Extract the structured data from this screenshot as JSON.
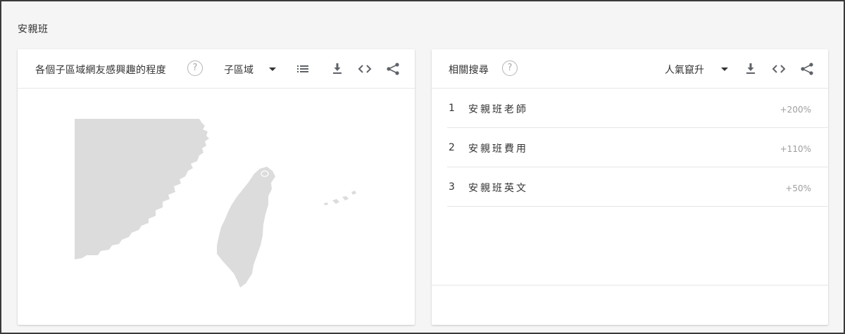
{
  "section": {
    "title": "安親班"
  },
  "left_panel": {
    "title": "各個子區域網友感興趣的程度",
    "help_glyph": "?",
    "dropdown_label": "子區域",
    "icons": [
      "help-circle-icon",
      "list-icon",
      "download-icon",
      "embed-code-icon",
      "share-icon"
    ]
  },
  "right_panel": {
    "title": "相關搜尋",
    "help_glyph": "?",
    "dropdown_label": "人氣竄升",
    "icons": [
      "help-circle-icon",
      "download-icon",
      "embed-code-icon",
      "share-icon"
    ],
    "rows": [
      {
        "rank": "1",
        "term": "安親班老師",
        "value": "+200%"
      },
      {
        "rank": "2",
        "term": "安親班費用",
        "value": "+110%"
      },
      {
        "rank": "3",
        "term": "安親班英文",
        "value": "+50%"
      }
    ]
  },
  "colors": {
    "background": "#f5f5f5",
    "map_fill": "#dcdcdc",
    "icon": "#5f6368",
    "muted": "#9e9e9e"
  }
}
